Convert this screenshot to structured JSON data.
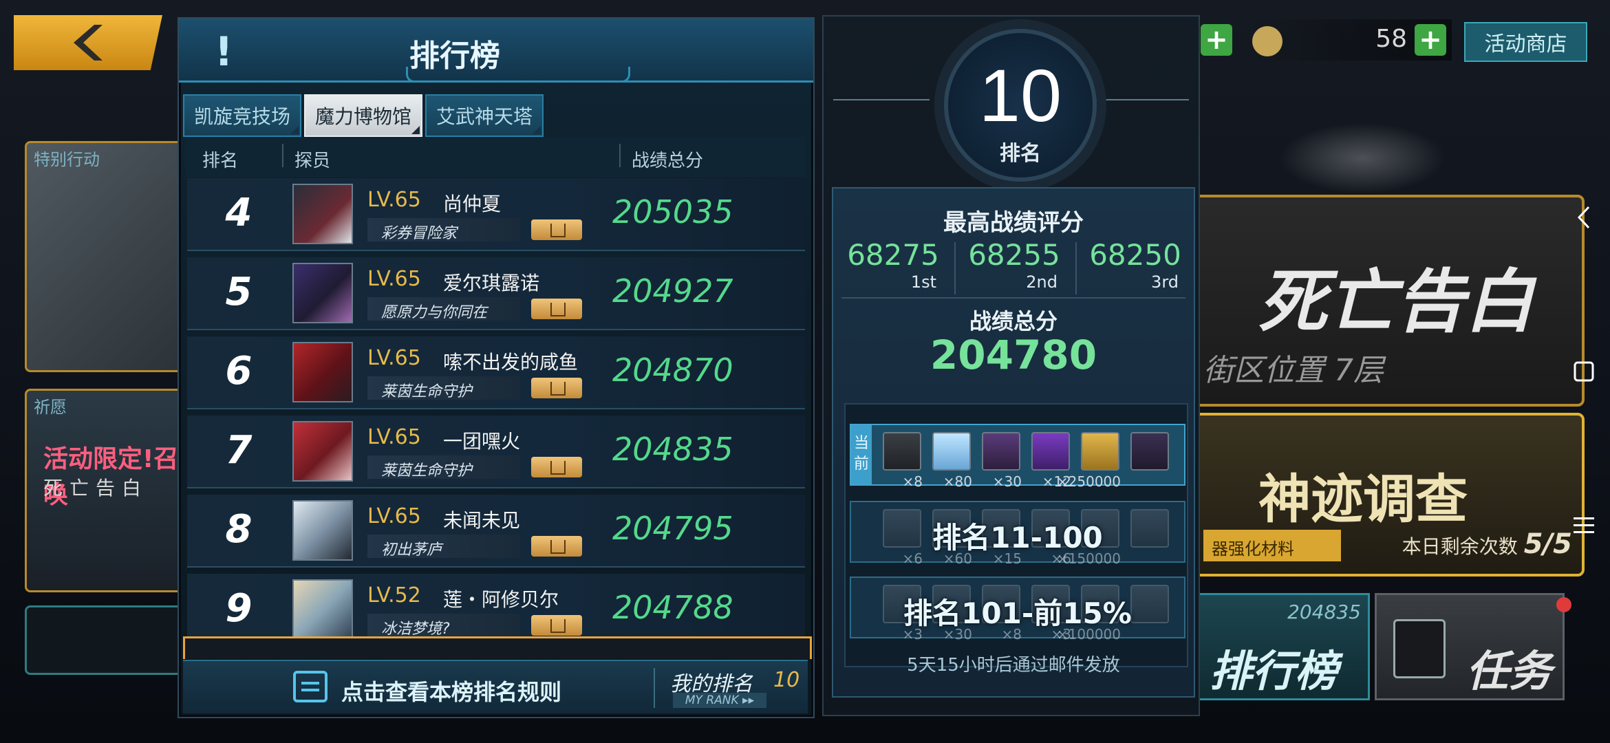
{
  "background": {
    "currency_value": "58",
    "shop_label": "活动商店",
    "event_card_tag": "特别行动",
    "gacha_card_tag": "祈愿",
    "gacha_promo": "活动限定!召唤",
    "gacha_sub": "死亡告白",
    "death_title": "死亡告白",
    "death_sub": "街区位置 7层",
    "miracle_title": "神迹调查",
    "miracle_bar": "器强化材料",
    "miracle_remaining_label": "本日剩余次数",
    "miracle_remaining_value": "5/5",
    "rank_button_label": "排行榜",
    "rank_button_score": "204835",
    "task_button_label": "任务"
  },
  "leaderboard": {
    "header_icon": "!",
    "title": "排行榜",
    "tabs": [
      {
        "label": "凯旋竞技场",
        "active": false
      },
      {
        "label": "魔力博物馆",
        "active": true
      },
      {
        "label": "艾武神天塔",
        "active": false
      }
    ],
    "columns": {
      "rank": "排名",
      "member": "探员",
      "score": "战绩总分"
    },
    "rows": [
      {
        "rank": "4",
        "level": "LV.65",
        "name": "尚仲夏",
        "title": "彩券冒险家",
        "score": "205035"
      },
      {
        "rank": "5",
        "level": "LV.65",
        "name": "爱尔琪露诺",
        "title": "愿原力与你同在",
        "score": "204927"
      },
      {
        "rank": "6",
        "level": "LV.65",
        "name": "嗦不出发的咸鱼",
        "title": "莱茵生命守护",
        "score": "204870"
      },
      {
        "rank": "7",
        "level": "LV.65",
        "name": "一团嘿火",
        "title": "莱茵生命守护",
        "score": "204835"
      },
      {
        "rank": "8",
        "level": "LV.65",
        "name": "未闻未见",
        "title": "初出茅庐",
        "score": "204795"
      },
      {
        "rank": "9",
        "level": "LV.52",
        "name": "莲・阿修贝尔",
        "title": "冰洁梦境?",
        "score": "204788"
      }
    ],
    "footer": {
      "rules_label": "点击查看本榜排名规则",
      "my_rank_label": "我的排名",
      "my_rank_value": "10",
      "my_rank_en": "MY RANK ▸▸"
    }
  },
  "reward": {
    "rank_number": "10",
    "rank_label": "排名",
    "best_title": "最高战绩评分",
    "best_scores": [
      {
        "value": "68275",
        "place": "1st"
      },
      {
        "value": "68255",
        "place": "2nd"
      },
      {
        "value": "68250",
        "place": "3rd"
      }
    ],
    "total_title": "战绩总分",
    "total_value": "204780",
    "current_tag": "当前",
    "tiers": [
      {
        "label": "",
        "items": [
          "×8",
          "×80",
          "×30",
          "×12",
          "×250000",
          ""
        ]
      },
      {
        "label": "排名11-100",
        "items": [
          "×6",
          "×60",
          "×15",
          "×6",
          "×150000",
          ""
        ]
      },
      {
        "label": "排名101-前15%",
        "items": [
          "×3",
          "×30",
          "×8",
          "×3",
          "×100000",
          ""
        ]
      }
    ],
    "footer_note": "5天15小时后通过邮件发放"
  },
  "colors": {
    "score_green": "#54d98c",
    "level_gold": "#e8b94a",
    "accent_blue": "#2b8fb6",
    "frame_orange": "#e9a43a"
  }
}
